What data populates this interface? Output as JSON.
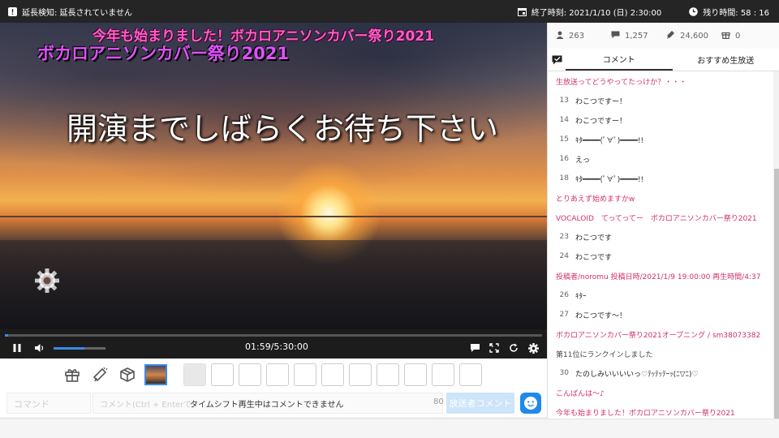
{
  "topbar": {
    "extension_label": "延長検知: 延長されていません",
    "end_time_label": "終了時刻: 2021/1/10 (日) 2:30:00",
    "remaining_label": "残り時間: 58 : 16"
  },
  "video": {
    "overlay_title": "今年も始まりました！ボカロアニソンカバー祭り2021",
    "overlay_subtitle": "ボカロアニソンカバー祭り2021",
    "overlay_waiting": "開演までしばらくお待ち下さい",
    "progress": 0.006,
    "volume": 0.6,
    "timecode": "01:59/5:30:00"
  },
  "input": {
    "command_placeholder": "コマンド",
    "comment_placeholder": "コメント(Ctrl + Enterで",
    "timeshift_message": "タイムシフト再生中はコメントできません",
    "char_count": "80",
    "broadcaster_label": "放送者コメント"
  },
  "stats": {
    "viewers": "263",
    "comments": "1,257",
    "ads": "24,600",
    "gifts": "0"
  },
  "tabs": {
    "comments": "コメント",
    "recommended": "おすすめ生放送"
  },
  "comments": [
    {
      "type": "op",
      "no": "",
      "text": "生放送ってどうやってたっけか？・・・"
    },
    {
      "type": "user",
      "no": "13",
      "text": "わこつですー！"
    },
    {
      "type": "user",
      "no": "14",
      "text": "わこつですー！"
    },
    {
      "type": "user",
      "no": "15",
      "text": "ｷﾀ━━━━(ﾟ∀ﾟ)━━━━!!"
    },
    {
      "type": "user",
      "no": "16",
      "text": "えっ"
    },
    {
      "type": "user",
      "no": "18",
      "text": "ｷﾀ━━━━(ﾟ∀ﾟ)━━━━!!"
    },
    {
      "type": "op",
      "no": "",
      "text": "とりあえず始めますかw"
    },
    {
      "type": "op",
      "no": "",
      "text": "VOCALOID　てってってー　ボカロアニソンカバー祭り2021"
    },
    {
      "type": "user",
      "no": "23",
      "text": "わこつです"
    },
    {
      "type": "user",
      "no": "24",
      "text": "わこつです"
    },
    {
      "type": "op",
      "no": "",
      "text": "投稿者/noromu 投稿日時/2021/1/9 19:00:00 再生時間/4:37"
    },
    {
      "type": "user",
      "no": "26",
      "text": "ｷﾀｰ"
    },
    {
      "type": "user",
      "no": "27",
      "text": "わこつです～！"
    },
    {
      "type": "op",
      "no": "",
      "text": "ボカロアニソンカバー祭り2021オープニング / sm38073382"
    },
    {
      "type": "sys",
      "no": "",
      "text": "第11位にランクインしました"
    },
    {
      "type": "user",
      "no": "30",
      "text": "たのしみいいいいっ♡ﾃｯﾃｯﾃｰｯ(ﾆ▽ﾆ)♡"
    },
    {
      "type": "op",
      "no": "",
      "text": "こんばんは～♪"
    },
    {
      "type": "op",
      "no": "",
      "text": "今年も始まりました！ボカロアニソンカバー祭り2021"
    }
  ],
  "colors": {
    "accent": "#1f8ae8",
    "operator_comment": "#d1306b",
    "overlay_title": "#ff5ec4",
    "overlay_subtitle": "#e050ff"
  },
  "icons": [
    "warning-icon",
    "calendar-icon",
    "clock-icon",
    "gear-icon",
    "play-pause-icon",
    "volume-icon",
    "comment-icon",
    "fullscreen-icon",
    "reload-icon",
    "settings-icon",
    "gift-icon",
    "ad-megaphone-icon",
    "box-icon",
    "viewer-icon",
    "comment-count-icon",
    "chat-toggle-icon",
    "face-icon"
  ]
}
